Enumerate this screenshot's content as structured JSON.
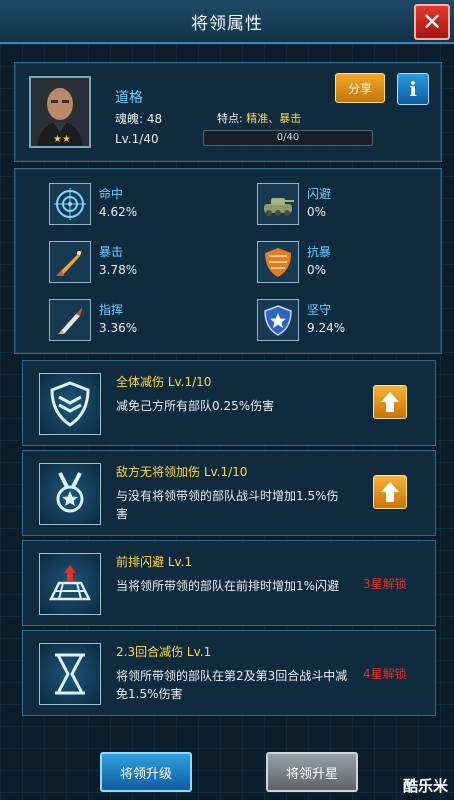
{
  "window": {
    "title": "将领属性",
    "close_label": "✕"
  },
  "hero": {
    "name": "道格",
    "soul": "魂魄: 48",
    "trait_label": "特点: ",
    "trait_value": "精准、暴击",
    "level": "Lv.1/40",
    "xp_text": "0/40",
    "xp_fraction": 0,
    "stars": "★★",
    "share_label": "分享",
    "info_label": "i"
  },
  "stats": [
    {
      "name": "命中",
      "value": "4.62%",
      "icon": "target-icon"
    },
    {
      "name": "闪避",
      "value": "0%",
      "icon": "tank-icon"
    },
    {
      "name": "暴击",
      "value": "3.78%",
      "icon": "missile-icon"
    },
    {
      "name": "抗暴",
      "value": "0%",
      "icon": "striped-shield-icon"
    },
    {
      "name": "指挥",
      "value": "3.36%",
      "icon": "rocket-icon"
    },
    {
      "name": "坚守",
      "value": "9.24%",
      "icon": "star-shield-icon"
    }
  ],
  "skills": [
    {
      "name": "全体减伤 Lv.1/10",
      "desc": "减免己方所有部队0.25%伤害",
      "action": "upgrade",
      "icon": "chevron-shield-icon"
    },
    {
      "name": "敌方无将领加伤 Lv.1/10",
      "desc": "与没有将领带领的部队战斗时增加1.5%伤害",
      "action": "upgrade",
      "icon": "medal-icon"
    },
    {
      "name": "前排闪避 Lv.1",
      "desc": "当将领所带领的部队在前排时增加1%闪避",
      "lock": "3星解锁",
      "icon": "formation-grid-icon"
    },
    {
      "name": "2.3回合减伤 Lv.1",
      "desc": "将领所带领的部队在第2及第3回合战斗中减免1.5%伤害",
      "lock": "4星解锁",
      "icon": "hourglass-icon"
    }
  ],
  "buttons": {
    "upgrade": "将领升级",
    "star": "将领升星"
  },
  "watermark": "酷乐米",
  "colors": {
    "accent": "#6fd0ff",
    "gold": "#ffd84a",
    "lock_red": "#e0322a",
    "orange_button": "#f3a72b"
  }
}
